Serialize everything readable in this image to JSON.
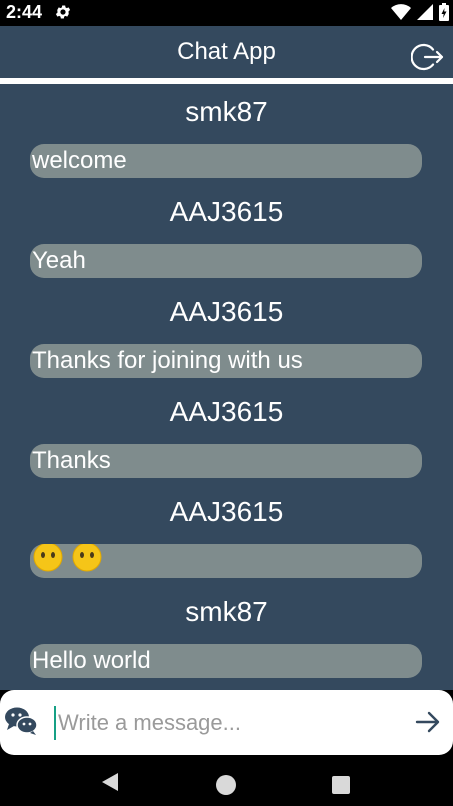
{
  "status_bar": {
    "time": "2:44"
  },
  "app_bar": {
    "title": "Chat App"
  },
  "messages": [
    {
      "sender": "smk87",
      "text": "welcome"
    },
    {
      "sender": "AAJ3615",
      "text": "Yeah"
    },
    {
      "sender": "AAJ3615",
      "text": "Thanks for joining with us"
    },
    {
      "sender": "AAJ3615",
      "text": "Thanks"
    },
    {
      "sender": "AAJ3615",
      "text": "😶😶"
    },
    {
      "sender": "smk87",
      "text": "Hello world"
    }
  ],
  "composer": {
    "placeholder": "Write a message...",
    "value": ""
  },
  "colors": {
    "app_bar": "#34495e",
    "chat_background": "#34495e",
    "bubble": "#7f8c8d",
    "accent": "#16a085"
  },
  "icons": {
    "status": [
      "gear-icon",
      "wifi-icon",
      "signal-icon",
      "battery-icon"
    ],
    "app_bar": [
      "logout-icon"
    ],
    "composer": [
      "chat-bubbles-icon",
      "send-arrow-icon"
    ],
    "nav": [
      "back-icon",
      "home-icon",
      "recents-icon"
    ]
  }
}
